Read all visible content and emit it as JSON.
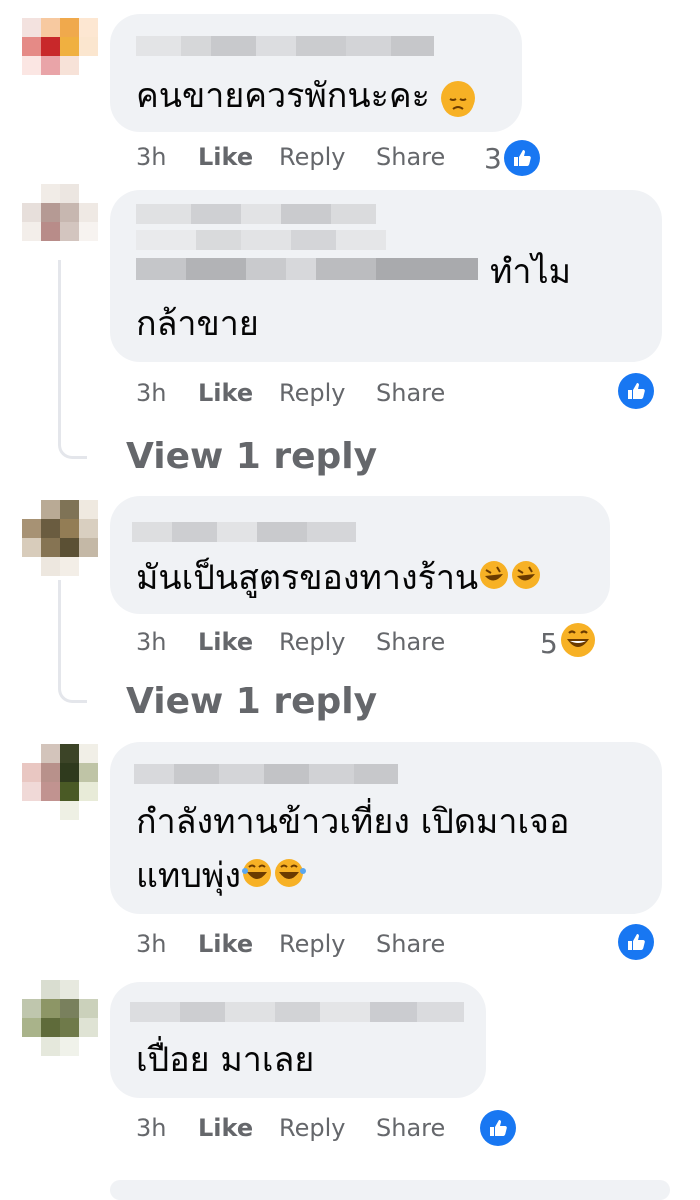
{
  "comments": [
    {
      "text_lines": [
        "คนขายควรพักนะคะ"
      ],
      "time": "3h",
      "like": "Like",
      "reply": "Reply",
      "share": "Share",
      "reaction_count": "3",
      "reaction": "like-icon"
    },
    {
      "text_lines": [
        "ทำไม",
        "กล้าขาย"
      ],
      "time": "3h",
      "like": "Like",
      "reply": "Reply",
      "share": "Share",
      "reaction": "like-icon"
    },
    {
      "text_lines": [
        "มันเป็นสูตรของทางร้าน"
      ],
      "time": "3h",
      "like": "Like",
      "reply": "Reply",
      "share": "Share",
      "reaction_count": "5",
      "reaction": "laugh-icon"
    },
    {
      "text_lines": [
        "กำลังทานข้าวเที่ยง เปิดมาเจอ",
        "แทบพุ่ง"
      ],
      "time": "3h",
      "like": "Like",
      "reply": "Reply",
      "share": "Share",
      "reaction": "like-icon"
    },
    {
      "text_lines": [
        "เปื่อย มาเลย"
      ],
      "time": "3h",
      "like": "Like",
      "reply": "Reply",
      "share": "Share",
      "reaction": "like-icon"
    }
  ],
  "view_replies": [
    "View 1 reply",
    "View 1 reply"
  ],
  "colors": {
    "bubble": "#f0f2f5",
    "like_blue": "#1877f2",
    "meta_text": "#65676b"
  }
}
